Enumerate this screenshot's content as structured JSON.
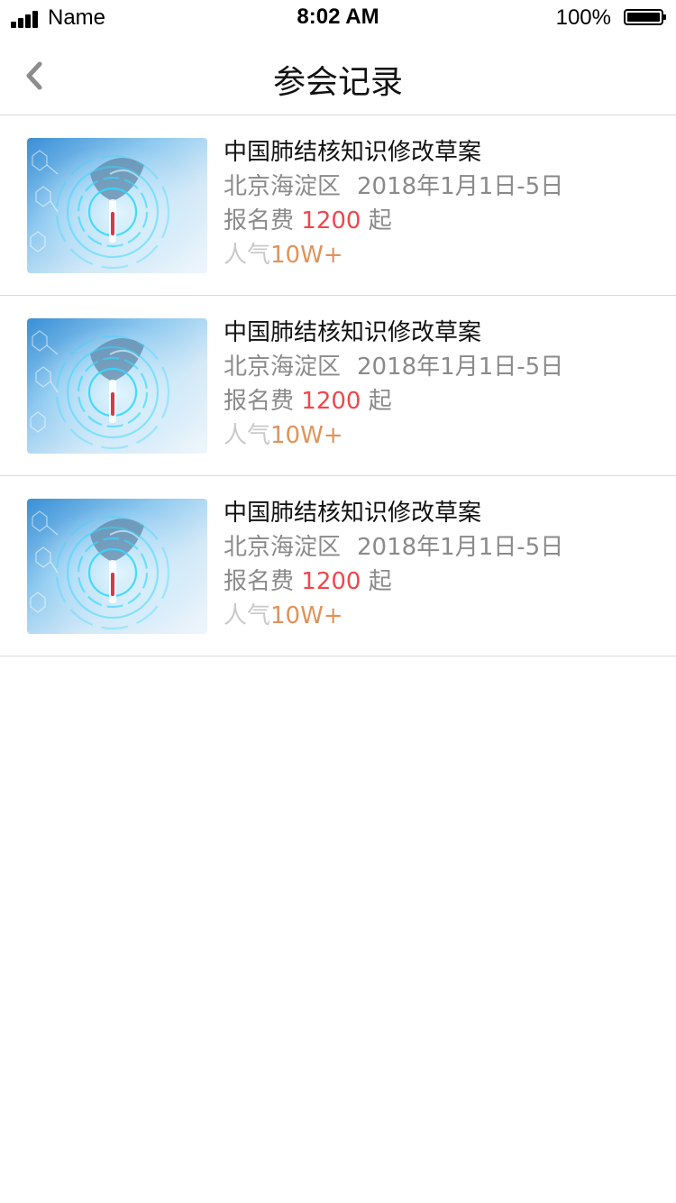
{
  "status_bar": {
    "carrier": "Name",
    "time": "8:02 AM",
    "battery": "100%"
  },
  "nav": {
    "title": "参会记录",
    "back_icon": "chevron-left-icon"
  },
  "records": [
    {
      "title": "中国肺结核知识修改草案",
      "location": "北京海淀区",
      "date": "2018年1月1日-5日",
      "fee_label": "报名费",
      "fee_value": "1200",
      "fee_suffix": "起",
      "popularity_label": "人气",
      "popularity_value": "10W+"
    },
    {
      "title": "中国肺结核知识修改草案",
      "location": "北京海淀区",
      "date": "2018年1月1日-5日",
      "fee_label": "报名费",
      "fee_value": "1200",
      "fee_suffix": "起",
      "popularity_label": "人气",
      "popularity_value": "10W+"
    },
    {
      "title": "中国肺结核知识修改草案",
      "location": "北京海淀区",
      "date": "2018年1月1日-5日",
      "fee_label": "报名费",
      "fee_value": "1200",
      "fee_suffix": "起",
      "popularity_label": "人气",
      "popularity_value": "10W+"
    }
  ],
  "colors": {
    "price": "#f0474b",
    "popularity": "#e0935a",
    "secondary_text": "#8a8a8a",
    "divider": "#d9d9d9"
  }
}
